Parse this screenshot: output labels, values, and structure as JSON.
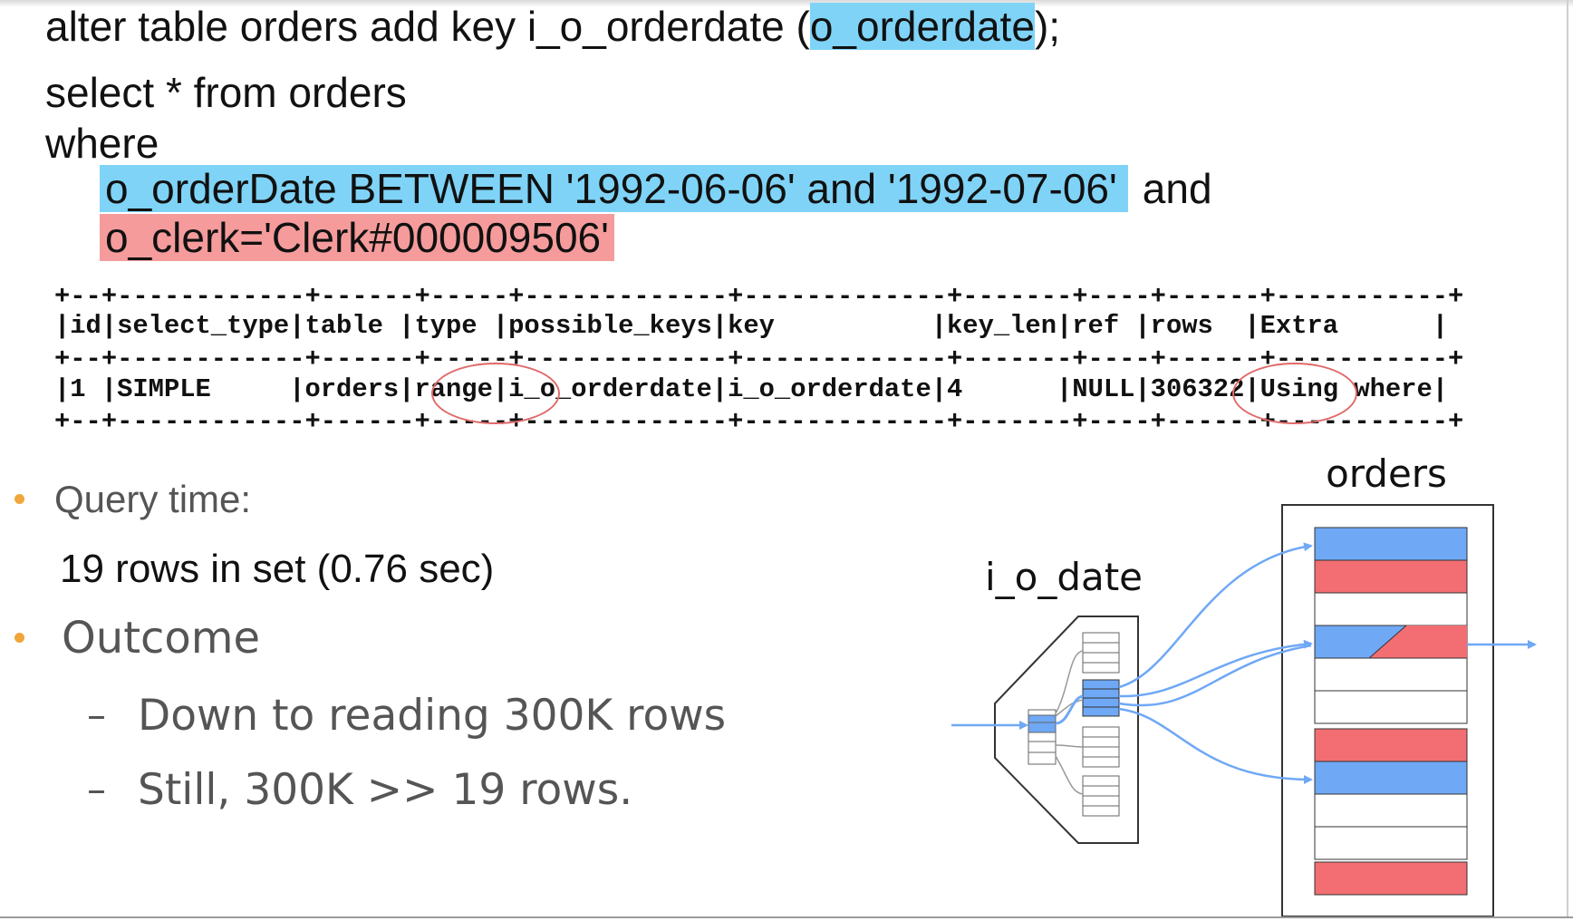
{
  "sql": {
    "line1_prefix": "alter table orders add key i_o_orderdate (",
    "line1_highlight": "o_orderdate",
    "line1_suffix": ");",
    "line2": "select * from orders",
    "line3": "where",
    "cond1": "o_orderDate BETWEEN '1992-06-06' and '1992-07-06'",
    "cond1_join": "and",
    "cond2": "o_clerk='Clerk#000009506'"
  },
  "explain": {
    "border_line": "+--+------------+------+-----+-------------+-------------+-------+----+------+-----------+",
    "header_row": "|id|select_type|table |type |possible_keys|key          |key_len|ref |rows  |Extra      |",
    "data_row": "|1 |SIMPLE     |orders|range|i_o_orderdate|i_o_orderdate|4      |NULL|306322|Using where|",
    "highlighted_cells": [
      "range",
      "306322"
    ]
  },
  "notes": {
    "query_time_label": "Query time:",
    "query_time_value": "19 rows in set (0.76 sec)",
    "outcome_label": "Outcome",
    "sub1_dash": "–",
    "sub1": "Down to reading 300K rows",
    "sub2_dash": "–",
    "sub2": "Still, 300K >> 19 rows."
  },
  "diagram": {
    "table_label": "orders",
    "index_label": "i_o_date"
  },
  "colors": {
    "highlight_blue": "#7fd3f7",
    "highlight_red": "#f59b9b",
    "row_blue": "#6fa8f5",
    "row_red": "#f26e72",
    "arrow": "#6fa8f5",
    "bullet": "#f0a63a",
    "circle": "#e06a6a"
  }
}
